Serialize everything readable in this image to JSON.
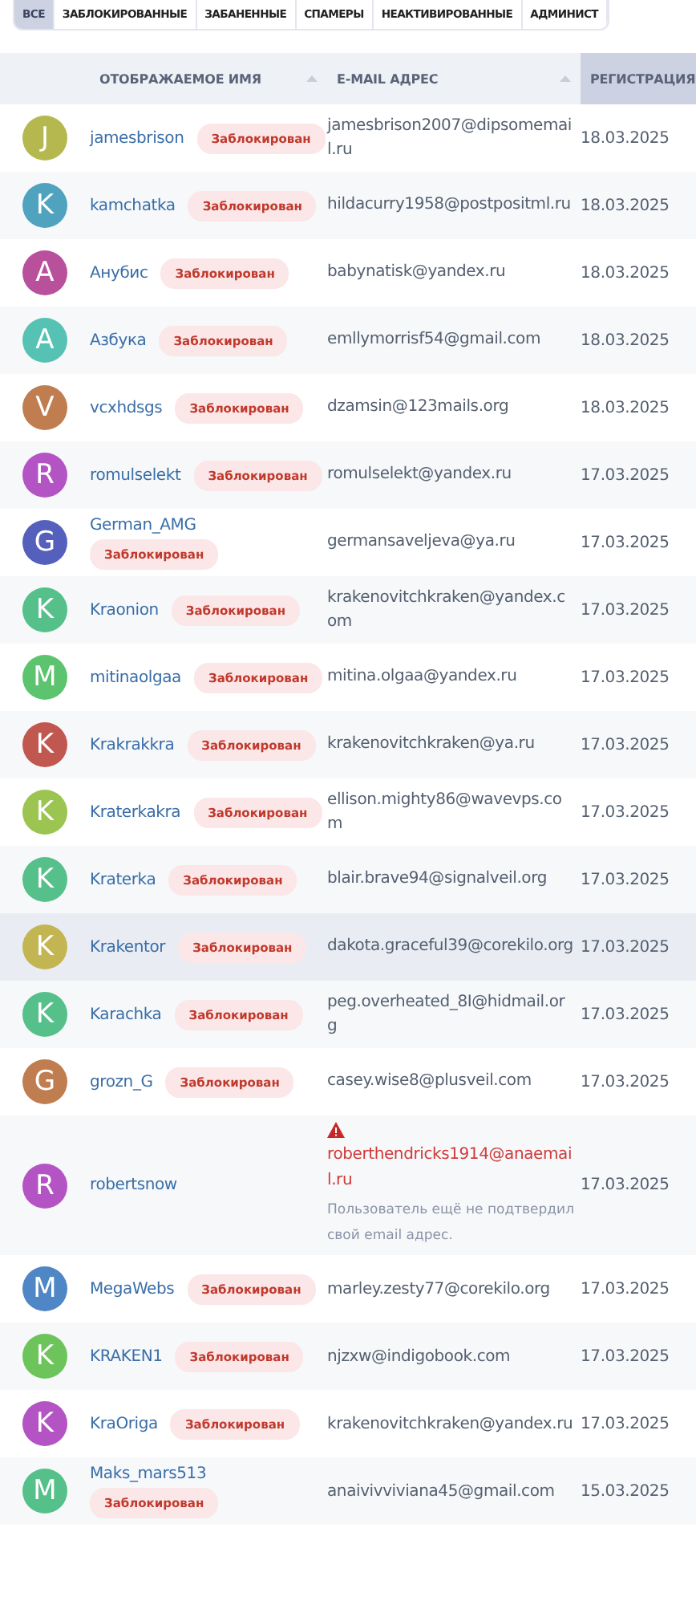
{
  "tabs": [
    {
      "label": "ВСЕ",
      "selected": true
    },
    {
      "label": "ЗАБЛОКИРОВАННЫЕ",
      "selected": false
    },
    {
      "label": "ЗАБАНЕННЫЕ",
      "selected": false
    },
    {
      "label": "СПАМЕРЫ",
      "selected": false
    },
    {
      "label": "НЕАКТИВИРОВАННЫЕ",
      "selected": false
    },
    {
      "label": "АДМИНИСТ",
      "selected": false
    }
  ],
  "table": {
    "columns": [
      {
        "label": "ОТОБРАЖАЕМОЕ ИМЯ",
        "sorted": false
      },
      {
        "label": "E-MAIL АДРЕС",
        "sorted": false
      },
      {
        "label": "РЕГИСТРАЦИЯ",
        "sorted": true
      }
    ],
    "rows": [
      {
        "initial": "J",
        "color": "#b5b84e",
        "name": "jamesbrison",
        "badge": "Заблокирован",
        "email": "jamesbrison2007@dipsomemail.ru",
        "email_unverified": false,
        "date": "18.03.2025",
        "highlighted": false
      },
      {
        "initial": "K",
        "color": "#4fa3bf",
        "name": "kamchatka",
        "badge": "Заблокирован",
        "email": "hildacurry1958@postpositml.ru",
        "email_unverified": false,
        "date": "18.03.2025",
        "highlighted": false
      },
      {
        "initial": "A",
        "color": "#b9509c",
        "name": "Анубис",
        "badge": "Заблокирован",
        "email": "babynatisk@yandex.ru",
        "email_unverified": false,
        "date": "18.03.2025",
        "highlighted": false
      },
      {
        "initial": "A",
        "color": "#56c2b3",
        "name": "Азбука",
        "badge": "Заблокирован",
        "email": "emllymorrisf54@gmail.com",
        "email_unverified": false,
        "date": "18.03.2025",
        "highlighted": false
      },
      {
        "initial": "V",
        "color": "#c07d4f",
        "name": "vcxhdsgs",
        "badge": "Заблокирован",
        "email": "dzamsin@123mails.org",
        "email_unverified": false,
        "date": "18.03.2025",
        "highlighted": false
      },
      {
        "initial": "R",
        "color": "#b453c4",
        "name": "romulselekt",
        "badge": "Заблокирован",
        "email": "romulselekt@yandex.ru",
        "email_unverified": false,
        "date": "17.03.2025",
        "highlighted": false
      },
      {
        "initial": "G",
        "color": "#5560bd",
        "name": "German_AMG",
        "badge": "Заблокирован",
        "email": "germansaveljeva@ya.ru",
        "email_unverified": false,
        "date": "17.03.2025",
        "highlighted": false
      },
      {
        "initial": "K",
        "color": "#55c08a",
        "name": "Kraonion",
        "badge": "Заблокирован",
        "email": "krakenovitchkraken@yandex.com",
        "email_unverified": false,
        "date": "17.03.2025",
        "highlighted": false
      },
      {
        "initial": "M",
        "color": "#5cc46e",
        "name": "mitinaolgaa",
        "badge": "Заблокирован",
        "email": "mitina.olgaa@yandex.ru",
        "email_unverified": false,
        "date": "17.03.2025",
        "highlighted": false
      },
      {
        "initial": "K",
        "color": "#c0584f",
        "name": "Krakrakkra",
        "badge": "Заблокирован",
        "email": "krakenovitchkraken@ya.ru",
        "email_unverified": false,
        "date": "17.03.2025",
        "highlighted": false
      },
      {
        "initial": "K",
        "color": "#9cc450",
        "name": "Kraterkakra",
        "badge": "Заблокирован",
        "email": "ellison.mighty86@wavevps.com",
        "email_unverified": false,
        "date": "17.03.2025",
        "highlighted": false
      },
      {
        "initial": "K",
        "color": "#55c08a",
        "name": "Kraterka",
        "badge": "Заблокирован",
        "email": "blair.brave94@signalveil.org",
        "email_unverified": false,
        "date": "17.03.2025",
        "highlighted": false
      },
      {
        "initial": "K",
        "color": "#c4b553",
        "name": "Krakentor",
        "badge": "Заблокирован",
        "email": "dakota.graceful39@corekilo.org",
        "email_unverified": false,
        "date": "17.03.2025",
        "highlighted": true
      },
      {
        "initial": "K",
        "color": "#55c08a",
        "name": "Karachka",
        "badge": "Заблокирован",
        "email": "peg.overheated_8I@hidmail.org",
        "email_unverified": false,
        "date": "17.03.2025",
        "highlighted": false
      },
      {
        "initial": "G",
        "color": "#c07d4f",
        "name": "grozn_G",
        "badge": "Заблокирован",
        "email": "casey.wise8@plusveil.com",
        "email_unverified": false,
        "date": "17.03.2025",
        "highlighted": false
      },
      {
        "initial": "R",
        "color": "#b453c4",
        "name": "robertsnow",
        "email": "roberthendricks1914@anaemail.ru",
        "email_unverified": true,
        "email_note": "Пользователь ещё не подтвердил свой email адрес.",
        "date": "17.03.2025",
        "highlighted": false
      },
      {
        "initial": "M",
        "color": "#4f86c6",
        "name": "MegaWebs",
        "badge": "Заблокирован",
        "email": "marley.zesty77@corekilo.org",
        "email_unverified": false,
        "date": "17.03.2025",
        "highlighted": false
      },
      {
        "initial": "K",
        "color": "#6cc45a",
        "name": "KRAKEN1",
        "badge": "Заблокирован",
        "email": "njzxw@indigobook.com",
        "email_unverified": false,
        "date": "17.03.2025",
        "highlighted": false
      },
      {
        "initial": "K",
        "color": "#b453c4",
        "name": "KraOriga",
        "badge": "Заблокирован",
        "email": "krakenovitchkraken@yandex.ru",
        "email_unverified": false,
        "date": "17.03.2025",
        "highlighted": false
      },
      {
        "initial": "M",
        "color": "#55c08a",
        "name": "Maks_mars513",
        "badge": "Заблокирован",
        "email": "anaivivviviana45@gmail.com",
        "email_unverified": false,
        "date": "15.03.2025",
        "highlighted": false
      }
    ]
  }
}
